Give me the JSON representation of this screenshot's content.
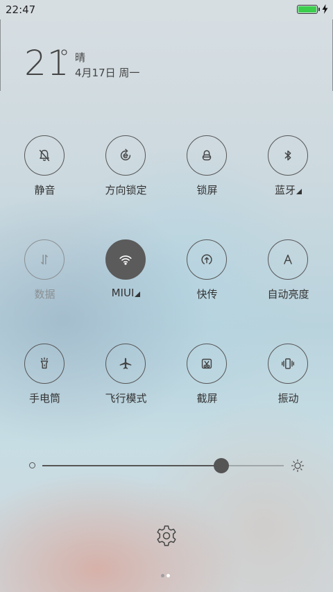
{
  "status_bar": {
    "time": "22:47",
    "battery_level": 1.0,
    "battery_color": "#3ccf4e"
  },
  "weather": {
    "temperature": "21",
    "degree": "°",
    "condition": "晴",
    "date": "4月17日 周一"
  },
  "toggles": [
    {
      "label": "静音",
      "icon": "silent-bell-icon",
      "state": "off"
    },
    {
      "label": "方向锁定",
      "icon": "rotation-lock-icon",
      "state": "off"
    },
    {
      "label": "锁屏",
      "icon": "lock-icon",
      "state": "off"
    },
    {
      "label": "蓝牙",
      "icon": "bluetooth-icon",
      "state": "off",
      "expandable": true
    },
    {
      "label": "数据",
      "icon": "mobile-data-icon",
      "state": "disabled"
    },
    {
      "label": "MIUI",
      "icon": "wifi-icon",
      "state": "on",
      "expandable": true
    },
    {
      "label": "快传",
      "icon": "quick-share-icon",
      "state": "off"
    },
    {
      "label": "自动亮度",
      "icon": "auto-brightness-icon",
      "state": "off"
    },
    {
      "label": "手电筒",
      "icon": "flashlight-icon",
      "state": "off"
    },
    {
      "label": "飞行模式",
      "icon": "airplane-icon",
      "state": "off"
    },
    {
      "label": "截屏",
      "icon": "screenshot-icon",
      "state": "off"
    },
    {
      "label": "振动",
      "icon": "vibrate-icon",
      "state": "off"
    }
  ],
  "brightness": {
    "level": 0.74
  },
  "pager": {
    "pages": 2,
    "current": 1
  },
  "colors": {
    "accent": "#5b5b5b",
    "disabled": "#8a8f92"
  }
}
